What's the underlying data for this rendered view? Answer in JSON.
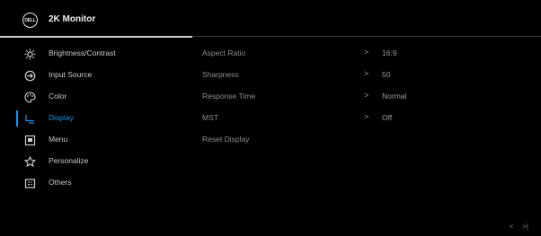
{
  "header": {
    "logo_text": "DELL",
    "title": "2K Monitor"
  },
  "sidebar": {
    "items": [
      {
        "label": "Brightness/Contrast",
        "icon": "brightness-icon",
        "active": false
      },
      {
        "label": "Input Source",
        "icon": "input-source-icon",
        "active": false
      },
      {
        "label": "Color",
        "icon": "color-palette-icon",
        "active": false
      },
      {
        "label": "Display",
        "icon": "display-icon",
        "active": true
      },
      {
        "label": "Menu",
        "icon": "menu-icon",
        "active": false
      },
      {
        "label": "Personalize",
        "icon": "star-icon",
        "active": false
      },
      {
        "label": "Others",
        "icon": "others-icon",
        "active": false
      }
    ]
  },
  "settings": {
    "rows": [
      {
        "name": "Aspect Ratio",
        "chevron": ">",
        "value": "16:9"
      },
      {
        "name": "Sharpness",
        "chevron": ">",
        "value": "50"
      },
      {
        "name": "Response Time",
        "chevron": ">",
        "value": "Normal"
      },
      {
        "name": "MST",
        "chevron": ">",
        "value": "Off"
      },
      {
        "name": "Reset Display",
        "chevron": "",
        "value": ""
      }
    ]
  },
  "footer": {
    "back": "<",
    "exit": ">|"
  },
  "colors": {
    "accent": "#1d8fe6",
    "background": "#000000"
  }
}
